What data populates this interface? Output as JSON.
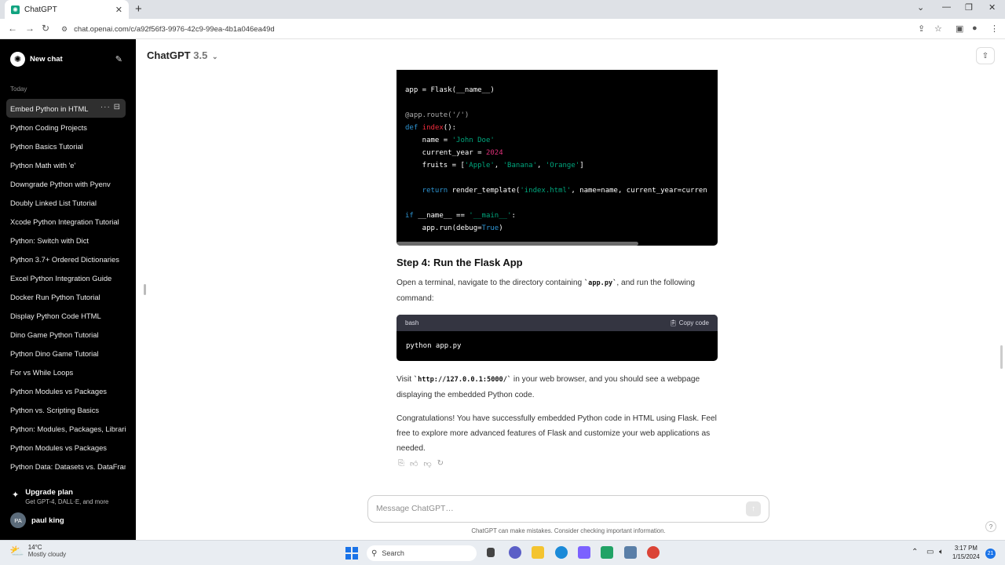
{
  "browser": {
    "tab_title": "ChatGPT",
    "url": "chat.openai.com/c/a92f56f3-9976-42c9-99ea-4b1a046ea49d"
  },
  "sidebar": {
    "new_chat": "New chat",
    "section": "Today",
    "items": [
      {
        "label": "Embed Python in HTML"
      },
      {
        "label": "Python Coding Projects"
      },
      {
        "label": "Python Basics Tutorial"
      },
      {
        "label": "Python Math with 'e'"
      },
      {
        "label": "Downgrade Python with Pyenv"
      },
      {
        "label": "Doubly Linked List Tutorial"
      },
      {
        "label": "Xcode Python Integration Tutorial"
      },
      {
        "label": "Python: Switch with Dict"
      },
      {
        "label": "Python 3.7+ Ordered Dictionaries"
      },
      {
        "label": "Excel Python Integration Guide"
      },
      {
        "label": "Docker Run Python Tutorial"
      },
      {
        "label": "Display Python Code HTML"
      },
      {
        "label": "Dino Game Python Tutorial"
      },
      {
        "label": "Python Dino Game Tutorial"
      },
      {
        "label": "For vs While Loops"
      },
      {
        "label": "Python Modules vs Packages"
      },
      {
        "label": "Python vs. Scripting Basics"
      },
      {
        "label": "Python: Modules, Packages, Libraries"
      },
      {
        "label": "Python Modules vs Packages"
      },
      {
        "label": "Python Data: Datasets vs. DataFrames"
      }
    ],
    "upgrade_title": "Upgrade plan",
    "upgrade_sub": "Get GPT-4, DALL·E, and more",
    "user_initials": "PA",
    "user_name": "paul king"
  },
  "header": {
    "model": "ChatGPT",
    "version": "3.5"
  },
  "code": {
    "l1": "app = Flask(__name__)",
    "l2": "@app.route('/')",
    "l3_kw": "def",
    "l3_fn": "index",
    "l3_rest": "():",
    "l4_a": "    name = ",
    "l4_s": "'John Doe'",
    "l5_a": "    current_year = ",
    "l5_n": "2024",
    "l6_a": "    fruits = [",
    "l6_s1": "'Apple'",
    "l6_s2": "'Banana'",
    "l6_s3": "'Orange'",
    "l6_b": "]",
    "l7_kw": "    return",
    "l7_a": " render_template(",
    "l7_s": "'index.html'",
    "l7_b": ", name=name, current_year=curren",
    "l8_kw": "if",
    "l8_a": " __name__ == ",
    "l8_s": "'__main__'",
    "l8_b": ":",
    "l9_a": "    app.run(debug=",
    "l9_kw": "True",
    "l9_b": ")"
  },
  "content": {
    "step4_heading": "Step 4: Run the Flask App",
    "p1_before": "Open a terminal, navigate to the directory containing ",
    "p1_code": "`app.py`",
    "p1_after": ", and run the following command:",
    "bash_lang": "bash",
    "copy_label": "Copy code",
    "bash_cmd": "python app.py",
    "p2_before": "Visit ",
    "p2_code": "`http://127.0.0.1:5000/`",
    "p2_after": " in your web browser, and you should see a webpage displaying the embedded Python code.",
    "p3": "Congratulations! You have successfully embedded Python code in HTML using Flask. Feel free to explore more advanced features of Flask and customize your web applications as needed."
  },
  "composer": {
    "placeholder": "Message ChatGPT…",
    "disclaimer": "ChatGPT can make mistakes. Consider checking important information."
  },
  "taskbar": {
    "temp": "14°C",
    "condition": "Mostly cloudy",
    "search": "Search",
    "time": "3:17 PM",
    "date": "1/15/2024",
    "notifications": "21"
  }
}
